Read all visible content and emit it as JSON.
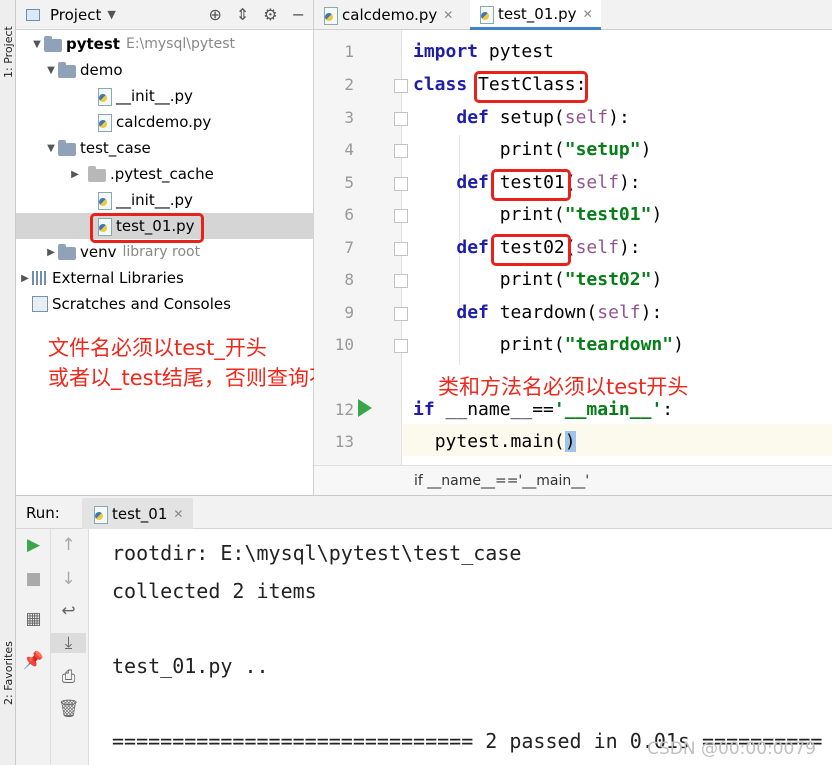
{
  "sidebar_tabs": {
    "project": "1: Project",
    "favorites": "2: Favorites"
  },
  "project_panel": {
    "title": "Project",
    "tree": [
      {
        "label": "pytest",
        "path": "E:\\mysql\\pytest"
      },
      {
        "label": "demo"
      },
      {
        "label": "__init__.py"
      },
      {
        "label": "calcdemo.py"
      },
      {
        "label": "test_case"
      },
      {
        "label": ".pytest_cache"
      },
      {
        "label": "__init__.py"
      },
      {
        "label": "test_01.py"
      },
      {
        "label": "venv",
        "note": "library root"
      },
      {
        "label": "External Libraries"
      },
      {
        "label": "Scratches and Consoles"
      }
    ]
  },
  "annotations": {
    "filename_rule_line1": "文件名必须以test_开头",
    "filename_rule_line2": "或者以_test结尾，否则查询不到",
    "class_method_rule": "类和方法名必须以test开头"
  },
  "editor": {
    "tabs": [
      "calcdemo.py",
      "test_01.py"
    ],
    "active_tab": "test_01.py",
    "line_numbers": [
      "1",
      "2",
      "3",
      "4",
      "5",
      "6",
      "7",
      "8",
      "9",
      "10",
      "12",
      "13"
    ],
    "breadcrumb": "if __name__=='__main__'",
    "code": {
      "l1_kw": "import",
      "l1_rest": " pytest",
      "l2_kw": "class",
      "l2_name": "TestClass",
      "l2_colon": ":",
      "def": "def",
      "print": "print",
      "self": "self",
      "l3_name": "setup",
      "l4_str": "\"setup\"",
      "l5_name": "test01",
      "l6_str": "\"test01\"",
      "l7_name": "test02",
      "l8_str": "\"test02\"",
      "l9_name": "teardown",
      "l10_str": "\"teardown\"",
      "l12_kw": "if",
      "l12_rest": " __name__==",
      "l12_str": "'__main__'",
      "l12_colon": ":",
      "l13_pre": "pytest.main(",
      "l13_paren": ")"
    }
  },
  "run_panel": {
    "label": "Run:",
    "tab": "test_01",
    "console": [
      "rootdir: E:\\mysql\\pytest\\test_case",
      "collected 2 items",
      "",
      "test_01.py ..",
      "",
      "============================== 2 passed in 0.01s =========="
    ],
    "watermark": "CSDN @00:00:0079"
  }
}
